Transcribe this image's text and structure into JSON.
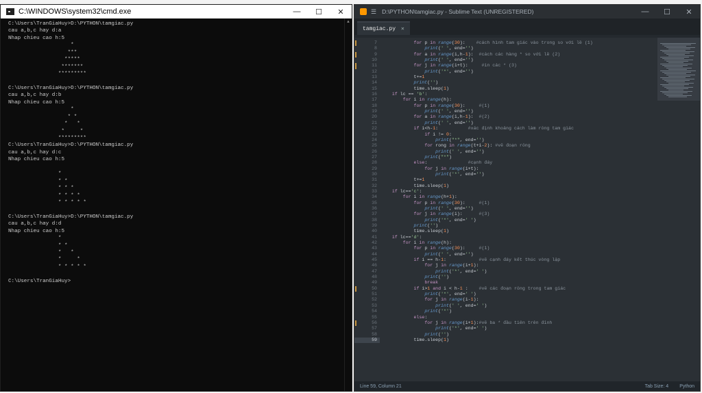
{
  "cmd": {
    "title": "C:\\WINDOWS\\system32\\cmd.exe",
    "lines": [
      "C:\\Users\\TranGiaHuy>D:\\PYTHON\\tamgiac.py",
      "cau a,b,c hay d:a",
      "Nhap chieu cao h:5",
      "                    *",
      "                   ***",
      "                  *****",
      "                 *******",
      "                *********",
      "",
      "C:\\Users\\TranGiaHuy>D:\\PYTHON\\tamgiac.py",
      "cau a,b,c hay d:b",
      "Nhap chieu cao h:5",
      "                    *",
      "                   * *",
      "                  *   *",
      "                 *     *",
      "                *********",
      "C:\\Users\\TranGiaHuy>D:\\PYTHON\\tamgiac.py",
      "cau a,b,c hay d:c",
      "Nhap chieu cao h:5",
      "",
      "                *",
      "                * *",
      "                * * *",
      "                * * * *",
      "                * * * * *",
      "",
      "C:\\Users\\TranGiaHuy>D:\\PYTHON\\tamgiac.py",
      "cau a,b,c hay d:d",
      "Nhap chieu cao h:5",
      "                *",
      "                * *",
      "                *   *",
      "                *     *",
      "                * * * * *",
      "",
      "C:\\Users\\TranGiaHuy>"
    ]
  },
  "sublime": {
    "title": "D:\\PYTHON\\tamgiac.py - Sublime Text (UNREGISTERED)",
    "tab_label": "tamgiac.py",
    "status_left": "Line 59, Column 21",
    "tab_size": "Tab Size: 4",
    "syntax": "Python",
    "code_lines": [
      {
        "n": "7",
        "mod": true,
        "t": "            for p in range(30):    #cách hình tam giác vào trong so với lề (1)"
      },
      {
        "n": "8",
        "mod": false,
        "t": "                print(' ', end='')"
      },
      {
        "n": "9",
        "mod": true,
        "t": "            for a in range(i,h-1):  #cách các hàng * so với lề (2)"
      },
      {
        "n": "10",
        "mod": false,
        "t": "                print(' ', end='')"
      },
      {
        "n": "11",
        "mod": true,
        "t": "            for j in range(i+t):     #in các * (3)"
      },
      {
        "n": "12",
        "mod": false,
        "t": "                print('*', end='')"
      },
      {
        "n": "13",
        "mod": false,
        "t": "            t+=1"
      },
      {
        "n": "14",
        "mod": false,
        "t": "            print('')"
      },
      {
        "n": "15",
        "mod": false,
        "t": "            time.sleep(1)"
      },
      {
        "n": "16",
        "mod": false,
        "t": "    if lc == 'b':"
      },
      {
        "n": "17",
        "mod": false,
        "t": "        for i in range(h):"
      },
      {
        "n": "18",
        "mod": false,
        "t": "            for p in range(30):     #(1)"
      },
      {
        "n": "19",
        "mod": false,
        "t": "                print(' ', end='')"
      },
      {
        "n": "20",
        "mod": false,
        "t": "            for a in range(i,h-1):  #(2)"
      },
      {
        "n": "21",
        "mod": false,
        "t": "                print(' ', end='')"
      },
      {
        "n": "22",
        "mod": false,
        "t": "            if i<h-1:           #xác định khoảng cách làm rỗng tam giác"
      },
      {
        "n": "23",
        "mod": false,
        "t": "                if i != 0:"
      },
      {
        "n": "24",
        "mod": false,
        "t": "                    print(\"*\", end='')"
      },
      {
        "n": "25",
        "mod": false,
        "t": "                for rong in range(t+i-2): #vẽ đoạn rỗng"
      },
      {
        "n": "26",
        "mod": false,
        "t": "                    print(' ', end='')"
      },
      {
        "n": "27",
        "mod": false,
        "t": "                print(\"*\")"
      },
      {
        "n": "28",
        "mod": false,
        "t": "            else:               #cạnh đáy"
      },
      {
        "n": "29",
        "mod": false,
        "t": "                for j in range(i+t):"
      },
      {
        "n": "30",
        "mod": false,
        "t": "                    print('*', end='')"
      },
      {
        "n": "31",
        "mod": false,
        "t": "            t+=1"
      },
      {
        "n": "32",
        "mod": false,
        "t": "            time.sleep(1)"
      },
      {
        "n": "33",
        "mod": false,
        "t": "    if lc=='c':"
      },
      {
        "n": "34",
        "mod": false,
        "t": "        for i in range(h+1):"
      },
      {
        "n": "35",
        "mod": false,
        "t": "            for p in range(30):     #(1)"
      },
      {
        "n": "36",
        "mod": false,
        "t": "                print(' ', end='')"
      },
      {
        "n": "37",
        "mod": false,
        "t": "            for j in range(i):      #(3)"
      },
      {
        "n": "38",
        "mod": false,
        "t": "                print('*', end=' ')"
      },
      {
        "n": "39",
        "mod": false,
        "t": "            print('')"
      },
      {
        "n": "40",
        "mod": false,
        "t": "            time.sleep(1)"
      },
      {
        "n": "41",
        "mod": false,
        "t": "    if lc=='d':"
      },
      {
        "n": "42",
        "mod": false,
        "t": "        for i in range(h):"
      },
      {
        "n": "43",
        "mod": false,
        "t": "            for p in range(30):     #(1)"
      },
      {
        "n": "44",
        "mod": false,
        "t": "                print(' ', end='')"
      },
      {
        "n": "45",
        "mod": false,
        "t": "            if i == h-1:            #vẽ cạnh đáy kết thúc vòng lặp"
      },
      {
        "n": "46",
        "mod": false,
        "t": "                for j in range(i+1):"
      },
      {
        "n": "47",
        "mod": false,
        "t": "                    print('*', end=' ')"
      },
      {
        "n": "48",
        "mod": false,
        "t": "                print('')"
      },
      {
        "n": "49",
        "mod": false,
        "t": "                break"
      },
      {
        "n": "50",
        "mod": true,
        "t": "            if i>1 and i < h-1 :    #vẽ các đoạn rỗng trong tam giác"
      },
      {
        "n": "51",
        "mod": false,
        "t": "                print('*', end=' ')"
      },
      {
        "n": "52",
        "mod": false,
        "t": "                for j in range(i-1):"
      },
      {
        "n": "53",
        "mod": false,
        "t": "                    print(' ', end=' ')"
      },
      {
        "n": "54",
        "mod": false,
        "t": "                print('*')"
      },
      {
        "n": "55",
        "mod": false,
        "t": "            else:"
      },
      {
        "n": "56",
        "mod": true,
        "t": "                for j in range(i+1):#vẽ ba * đầu tiên trên đỉnh"
      },
      {
        "n": "57",
        "mod": false,
        "t": "                    print('*', end=' ')"
      },
      {
        "n": "58",
        "mod": false,
        "t": "                print('')"
      },
      {
        "n": "59",
        "mod": false,
        "t": "            time.sleep(1)"
      }
    ]
  }
}
